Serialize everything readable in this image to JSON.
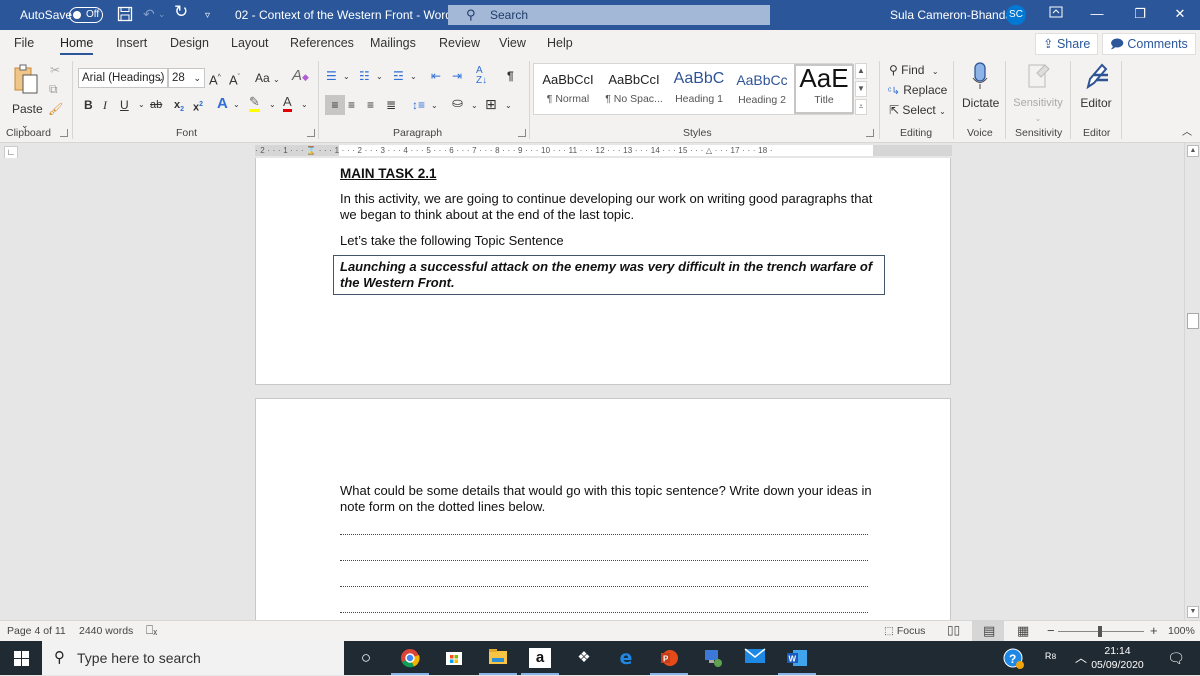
{
  "titlebar": {
    "autosave_label": "AutoSave",
    "autosave_state": "Off",
    "doc_title": "02 - Context of the Western Front  -  Word",
    "search_placeholder": "Search",
    "user_name": "Sula Cameron-Bhandal",
    "user_initials": "SC",
    "icons": [
      "save-icon",
      "undo-icon",
      "redo-icon",
      "customize-qat-icon",
      "ribbon-display-icon",
      "minimize-icon",
      "restore-icon",
      "close-icon"
    ]
  },
  "tabs": {
    "items": [
      "File",
      "Home",
      "Insert",
      "Design",
      "Layout",
      "References",
      "Mailings",
      "Review",
      "View",
      "Help"
    ],
    "active": "Home",
    "share_label": "Share",
    "comments_label": "Comments"
  },
  "ribbon": {
    "clipboard": {
      "paste_label": "Paste",
      "group_label": "Clipboard"
    },
    "font": {
      "font_name": "Arial (Headings)",
      "font_size": "28",
      "change_case": "Aa",
      "group_label": "Font",
      "colors": {
        "highlight": "#ffff00",
        "font_color": "#e00000",
        "text_effects": "#2f6fd6"
      }
    },
    "paragraph": {
      "group_label": "Paragraph"
    },
    "styles": {
      "group_label": "Styles",
      "items": [
        {
          "preview": "AaBbCcI",
          "label": "¶ Normal"
        },
        {
          "preview": "AaBbCcI",
          "label": "¶ No Spac..."
        },
        {
          "preview": "AaBbC",
          "label": "Heading 1"
        },
        {
          "preview": "AaBbCc",
          "label": "Heading 2"
        },
        {
          "preview": "AaE",
          "label": "Title"
        }
      ],
      "selected": "Title"
    },
    "editing": {
      "find": "Find",
      "replace": "Replace",
      "select": "Select",
      "group_label": "Editing"
    },
    "voice": {
      "dictate": "Dictate",
      "group_label": "Voice"
    },
    "sensitivity": {
      "button": "Sensitivity",
      "group_label": "Sensitivity"
    },
    "editor": {
      "button": "Editor",
      "group_label": "Editor"
    }
  },
  "ruler": {
    "labels": "· 2 · · · 1 · · · ⌛ · · · 1 · · · 2 · · · 3 · · · 4 · · · 5 · · · 6 · · · 7 · · · 8 · · · 9 · · · 10 · · · 11 · · · 12 · · · 13 · · · 14 · · · 15 · · · △ · · · 17 · · · 18 ·"
  },
  "document": {
    "page1": {
      "heading": "MAIN TASK 2.1",
      "para1_line1": "In this activity, we are going to continue developing our work on writing good paragraphs that",
      "para1_line2": "we began to think about at the end of the last topic.",
      "para2": "Let’s take the following Topic Sentence",
      "topic_line1": "Launching a successful attack on the enemy was very difficult in the trench warfare of",
      "topic_line2": "the Western Front."
    },
    "page2": {
      "question_line1": "What could be some details that would go with this topic sentence?  Write down your ideas in",
      "question_line2": "note form on the dotted lines below.",
      "dotted_lines": 4
    }
  },
  "statusbar": {
    "page": "Page 4 of 11",
    "words": "2440 words",
    "focus": "Focus",
    "zoom": "100%",
    "zoom_minus": "−",
    "zoom_plus": "+",
    "active_view": "print-layout"
  },
  "taskbar": {
    "search_placeholder": "Type here to search",
    "apps": [
      "cortana",
      "chrome",
      "microsoft-store",
      "file-explorer",
      "amazon",
      "dropbox",
      "edge",
      "powerpoint",
      "remote-desktop",
      "mail",
      "word"
    ],
    "time": "21:14",
    "date": "05/09/2020"
  }
}
